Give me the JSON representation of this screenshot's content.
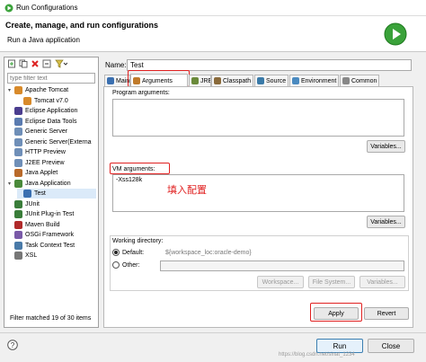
{
  "window": {
    "title": "Run Configurations"
  },
  "banner": {
    "heading": "Create, manage, and run configurations",
    "subtitle": "Run a Java application"
  },
  "left_panel": {
    "filter_placeholder": "type filter text",
    "tree": [
      {
        "label": "Apache Tomcat",
        "icon": "tomcat-icon",
        "level": 0,
        "expanded": true
      },
      {
        "label": "Tomcat v7.0",
        "icon": "tomcat-icon",
        "level": 1
      },
      {
        "label": "Eclipse Application",
        "icon": "eclipse-icon",
        "level": 0
      },
      {
        "label": "Eclipse Data Tools",
        "icon": "data-tools-icon",
        "level": 0
      },
      {
        "label": "Generic Server",
        "icon": "server-icon",
        "level": 0
      },
      {
        "label": "Generic Server(Externa",
        "icon": "server-icon",
        "level": 0
      },
      {
        "label": "HTTP Preview",
        "icon": "server-icon",
        "level": 0
      },
      {
        "label": "J2EE Preview",
        "icon": "server-icon",
        "level": 0
      },
      {
        "label": "Java Applet",
        "icon": "applet-icon",
        "level": 0
      },
      {
        "label": "Java Application",
        "icon": "java-app-icon",
        "level": 0,
        "expanded": true
      },
      {
        "label": "Test",
        "icon": "java-class-icon",
        "level": 1,
        "selected": true
      },
      {
        "label": "JUnit",
        "icon": "junit-icon",
        "level": 0
      },
      {
        "label": "JUnit Plug-in Test",
        "icon": "junit-icon",
        "level": 0
      },
      {
        "label": "Maven Build",
        "icon": "maven-icon",
        "level": 0
      },
      {
        "label": "OSGi Framework",
        "icon": "osgi-icon",
        "level": 0
      },
      {
        "label": "Task Context Test",
        "icon": "task-icon",
        "level": 0
      },
      {
        "label": "XSL",
        "icon": "xsl-icon",
        "level": 0
      }
    ],
    "status": "Filter matched 19 of 30 items"
  },
  "right_panel": {
    "name_label": "Name:",
    "name_value": "Test",
    "tabs": [
      {
        "label": "Main",
        "icon": "main-tab-icon"
      },
      {
        "label": "Arguments",
        "icon": "arguments-tab-icon",
        "active": true
      },
      {
        "label": "JRE",
        "icon": "jre-tab-icon"
      },
      {
        "label": "Classpath",
        "icon": "classpath-tab-icon"
      },
      {
        "label": "Source",
        "icon": "source-tab-icon"
      },
      {
        "label": "Environment",
        "icon": "environment-tab-icon"
      },
      {
        "label": "Common",
        "icon": "common-tab-icon"
      }
    ],
    "program_args_label": "Program arguments:",
    "program_args_value": "",
    "variables_label_1": "Variables...",
    "vm_args_label": "VM arguments:",
    "vm_args_value": "-Xss128k",
    "annotation": "填入配置",
    "variables_label_2": "Variables...",
    "working_dir_label": "Working directory:",
    "default_label": "Default:",
    "default_value": "${workspace_loc:oracle-demo}",
    "other_label": "Other:",
    "workspace_btn": "Workspace...",
    "filesystem_btn": "File System...",
    "variables_label_3": "Variables...",
    "apply_label": "Apply",
    "revert_label": "Revert"
  },
  "footer": {
    "run_label": "Run",
    "close_label": "Close",
    "watermark": "https://blog.csdn.net/sinat_1234"
  },
  "colors": {
    "annotation_red": "#e02020",
    "selection": "#dbeaf9",
    "run_green": "#3aa23a"
  }
}
